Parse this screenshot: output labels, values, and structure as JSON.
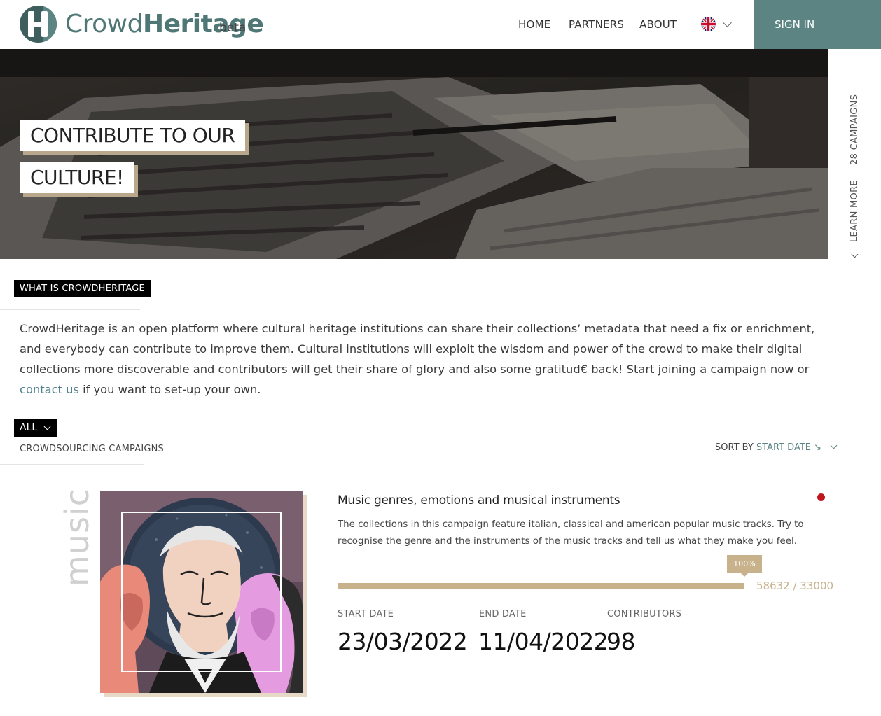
{
  "brand": {
    "name_light": "Crowd",
    "name_bold": "Heritage",
    "beta": "beta"
  },
  "nav": {
    "home": "HOME",
    "partners": "PARTNERS",
    "about": "ABOUT",
    "language": "en-GB flag",
    "sign_in": "SIGN IN"
  },
  "hero": {
    "line1": "CONTRIBUTE TO OUR",
    "line2": "CULTURE!"
  },
  "side": {
    "campaigns": "28 CAMPAIGNS",
    "learn_more": "LEARN MORE"
  },
  "what_is": {
    "tag": "WHAT IS CROWDHERITAGE",
    "text_before": "CrowdHeritage is an open platform where cultural heritage institutions can share their collections’ metadata that need a fix or enrichment, and everybody can contribute to improve them. Cultural institutions will exploit the wisdom and power of the crowd to make their digital collections more discoverable and contributors will get their share of glory and also some gratitud€ back! Start joining a campaign now or ",
    "link": "contact us",
    "text_after": " if you want to set-up your own."
  },
  "campaigns": {
    "filter": "ALL",
    "subtitle": "CROWDSOURCING CAMPAIGNS",
    "sort_prefix": "SORT BY ",
    "sort_value": "START DATE ↘",
    "items": [
      {
        "category": "music",
        "title": "Music genres, emotions and musical instruments",
        "description": "The collections in this campaign feature italian, classical and american popular music tracks. Try to recognise the genre and the instruments of the music tracks and tell us what they make you feel.",
        "percent": "100%",
        "progress": 1.0,
        "count": "58632 / 33000",
        "start_label": "START DATE",
        "start_date": "23/03/2022",
        "end_label": "END DATE",
        "end_date": "11/04/2022",
        "contributors_label": "CONTRIBUTORS",
        "contributors": "98",
        "status_color": "#c0151f"
      }
    ]
  },
  "colors": {
    "brand": "#5b8483",
    "accent": "#c7b28c",
    "logo_dark": "#3f5f5e"
  }
}
